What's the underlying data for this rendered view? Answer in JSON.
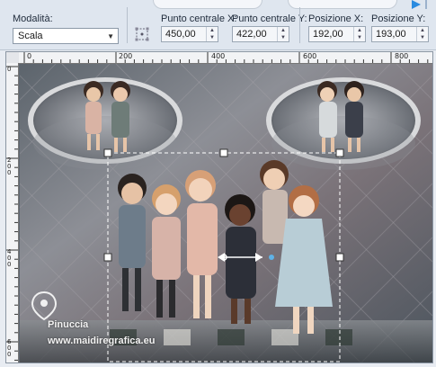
{
  "toolbar": {
    "mode_label": "Modalità:",
    "mode_value": "Scala",
    "center_x_label": "Punto centrale X:",
    "center_x_value": "450,00",
    "center_y_label": "Punto centrale Y:",
    "center_y_value": "422,00",
    "pos_x_label": "Posizione X:",
    "pos_x_value": "192,00",
    "pos_y_label": "Posizione Y:",
    "pos_y_value": "193,00"
  },
  "ruler": {
    "h_labels": [
      "0",
      "200",
      "400",
      "600",
      "800"
    ],
    "v_labels": [
      "0",
      "200",
      "400",
      "600"
    ]
  },
  "watermark": {
    "name": "Pinuccia",
    "site": "www.maidiregrafica.eu"
  },
  "colors": {
    "toolbar_bg": "#dfe6ef",
    "selection_handle": "#ffffff",
    "accent": "#2a8be0"
  },
  "icons": {
    "anchor": "pick-anchor-icon",
    "play": "play-icon",
    "combo_caret": "chevron-down-icon"
  }
}
